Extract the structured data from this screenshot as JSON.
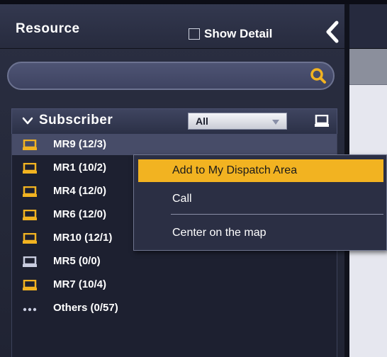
{
  "panel": {
    "title": "Resource",
    "show_detail_label": "Show Detail",
    "show_detail_checked": false
  },
  "search": {
    "placeholder": "",
    "value": ""
  },
  "subscriber": {
    "header_label": "Subscriber",
    "filter_value": "All"
  },
  "list": [
    {
      "label": "MR9 (12/3)",
      "icon": "terminal-icon",
      "icon_color": "#f2b321",
      "highlighted": true
    },
    {
      "label": "MR1 (10/2)",
      "icon": "terminal-icon",
      "icon_color": "#f2b321"
    },
    {
      "label": "MR4 (12/0)",
      "icon": "terminal-icon",
      "icon_color": "#f2b321"
    },
    {
      "label": "MR6 (12/0)",
      "icon": "terminal-icon",
      "icon_color": "#f2b321"
    },
    {
      "label": "MR10 (12/1)",
      "icon": "terminal-icon",
      "icon_color": "#f2b321"
    },
    {
      "label": "MR5 (0/0)",
      "icon": "terminal-icon",
      "icon_color": "#c9cde0"
    },
    {
      "label": "MR7 (10/4)",
      "icon": "terminal-icon",
      "icon_color": "#f2b321"
    },
    {
      "label": "Others (0/57)",
      "icon": "more-icon",
      "icon_color": "#c9cde0"
    }
  ],
  "context_menu": {
    "items": [
      {
        "label": "Add to My Dispatch Area",
        "active": true
      },
      {
        "label": "Call"
      },
      {
        "label": "Center on the map"
      }
    ]
  },
  "colors": {
    "accent": "#f2b321",
    "panel_bg": "#242838",
    "highlight_row": "#474c68"
  }
}
